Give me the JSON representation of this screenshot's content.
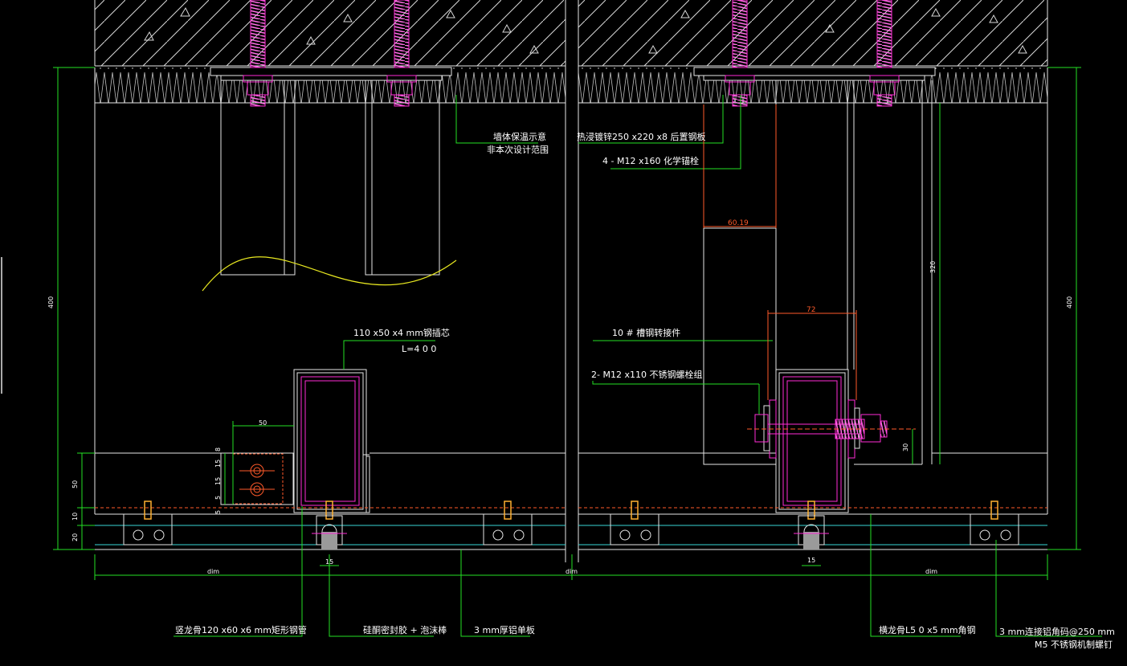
{
  "colors": {
    "background": "#000000",
    "line_white": "#e6e6e6",
    "leader_green": "#25e025",
    "bolt_magenta": "#ff2bd6",
    "dim_red": "#ff5a2a",
    "curve_yellow": "#e8e820",
    "clip_orange": "#ffb030",
    "panel_cyan": "#38d6d6"
  },
  "labels": {
    "insulation": [
      "墙体保温示意",
      "非本次设计范围"
    ],
    "back_plate": "热浸镀锌250 x220 x8 后置钢板",
    "chem_anchor": "4 - M12 x160 化学锚栓",
    "insert_core": [
      "110 x50 x4 mm钢插芯",
      "L=4 0 0"
    ],
    "channel_conn": "10 # 槽钢转接件",
    "ss_bolt": "2- M12 x110 不锈钢螺栓组",
    "mullion": "竖龙骨120 x60 x6 mm矩形钢管",
    "sealant": "硅酮密封胶 + 泡沫棒",
    "al_panel": "3 mm厚铝单板",
    "transom": "横龙骨L5 0 x5 mm角钢",
    "al_clip": [
      "3 mm连接铝角码@250 mm",
      "M5 不锈钢机制螺钉"
    ]
  },
  "dimensions": {
    "left_height": "400",
    "right_height": "400",
    "inner_320": "320",
    "d_6019": "60.19",
    "d_72": "72",
    "d_50_h": "50",
    "d_50_v": "50",
    "d_10": "10",
    "d_20": "20",
    "d_8": "8",
    "d_15a": "15",
    "d_15b": "15",
    "d_5a": "5",
    "d_5b": "5",
    "d_15_left": "15",
    "d_15_right": "15",
    "d_30": "30",
    "dim_left": "dim",
    "dim_mid": "dim",
    "dim_right": "dim"
  }
}
